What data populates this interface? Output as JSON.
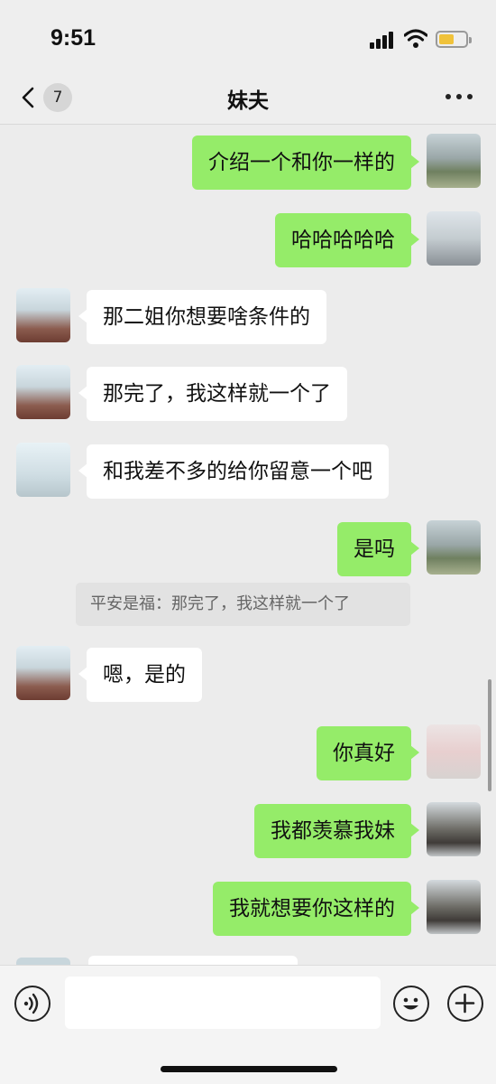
{
  "status_bar": {
    "time": "9:51"
  },
  "header": {
    "back_badge": "7",
    "title": "妹夫"
  },
  "messages": [
    {
      "side": "out",
      "text": "介绍一个和你一样的"
    },
    {
      "side": "out",
      "text": "哈哈哈哈哈"
    },
    {
      "side": "in",
      "text": "那二姐你想要啥条件的"
    },
    {
      "side": "in",
      "text": "那完了，我这样就一个了"
    },
    {
      "side": "in",
      "text": "和我差不多的给你留意一个吧"
    },
    {
      "side": "out",
      "text": "是吗"
    },
    {
      "side": "in",
      "text": "嗯，是的"
    },
    {
      "side": "out",
      "text": "你真好"
    },
    {
      "side": "out",
      "text": "我都羡慕我妹"
    },
    {
      "side": "out",
      "text": "我就想要你这样的"
    }
  ],
  "quote": {
    "text": "平安是福：那完了，我这样就一个了"
  },
  "input_bar": {
    "placeholder": "",
    "icons": [
      "voice-icon",
      "emoji-icon",
      "plus-icon"
    ]
  },
  "colors": {
    "outgoing_bubble": "#95ec69",
    "incoming_bubble": "#ffffff",
    "background": "#ececec"
  }
}
